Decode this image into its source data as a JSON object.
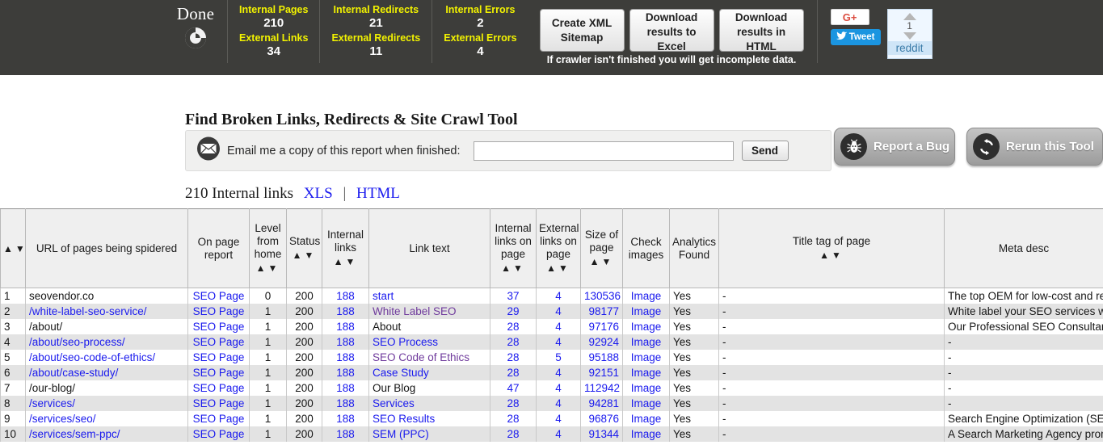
{
  "topbar": {
    "status": "Done",
    "spinner_icon": "spinner-icon",
    "stats": [
      {
        "label": "Internal Pages",
        "value": "210",
        "label2": "External Links",
        "value2": "34"
      },
      {
        "label": "Internal Redirects",
        "value": "21",
        "label2": "External Redirects",
        "value2": "11"
      },
      {
        "label": "Internal Errors",
        "value": "2",
        "label2": "External Errors",
        "value2": "4"
      }
    ],
    "buttons": [
      "Create XML Sitemap",
      "Download results to Excel",
      "Download results in HTML"
    ],
    "crawler_note": "If crawler isn't finished you will get incomplete data.",
    "social": {
      "gplus_label": "G+",
      "tweet_label": "Tweet",
      "reddit_count": "1",
      "reddit_label": "reddit"
    }
  },
  "main": {
    "page_title": "Find Broken Links, Redirects & Site Crawl Tool",
    "email_label": "Email me a copy of this report when finished:",
    "email_value": "",
    "email_placeholder": "",
    "send_label": "Send",
    "report_bug_label": "Report a Bug",
    "rerun_label": "Rerun this Tool",
    "links_summary": "210 Internal links",
    "xls_label": "XLS",
    "separator": "|",
    "html_label": "HTML"
  },
  "table": {
    "headers": [
      {
        "label": "",
        "sort": true
      },
      {
        "label": "URL of pages being spidered",
        "sort": false
      },
      {
        "label": "On page report",
        "sort": false
      },
      {
        "label": "Level from home",
        "sort": true
      },
      {
        "label": "Status",
        "sort": true
      },
      {
        "label": "Internal links",
        "sort": true
      },
      {
        "label": "Link text",
        "sort": false
      },
      {
        "label": "Internal links on page",
        "sort": true
      },
      {
        "label": "External links on page",
        "sort": true
      },
      {
        "label": "Size of page",
        "sort": true
      },
      {
        "label": "Check images",
        "sort": false
      },
      {
        "label": "Analytics Found",
        "sort": false
      },
      {
        "label": "Title tag of page",
        "sort": true
      },
      {
        "label": "Meta desc",
        "sort": false
      }
    ],
    "sort_up": "▲",
    "sort_down": "▼",
    "rows": [
      {
        "n": "1",
        "url": "seovendor.co",
        "url_style": "black",
        "report": "SEO Page",
        "level": "0",
        "status": "200",
        "internal": "188",
        "text": "start",
        "text_style": "link",
        "intpage": "37",
        "extpage": "4",
        "size": "130536",
        "images": "Image",
        "analytics": "Yes",
        "title": "-",
        "meta": "The top OEM for low-cost and re"
      },
      {
        "n": "2",
        "url": "/white-label-seo-service/",
        "url_style": "link",
        "report": "SEO Page",
        "level": "1",
        "status": "200",
        "internal": "188",
        "text": "White Label SEO",
        "text_style": "visited",
        "intpage": "29",
        "extpage": "4",
        "size": "98177",
        "images": "Image",
        "analytics": "Yes",
        "title": "-",
        "meta": "White label your SEO services wi"
      },
      {
        "n": "3",
        "url": "/about/",
        "url_style": "black",
        "report": "SEO Page",
        "level": "1",
        "status": "200",
        "internal": "188",
        "text": "About",
        "text_style": "black",
        "intpage": "28",
        "extpage": "4",
        "size": "97176",
        "images": "Image",
        "analytics": "Yes",
        "title": "-",
        "meta": "Our Professional SEO Consultant"
      },
      {
        "n": "4",
        "url": "/about/seo-process/",
        "url_style": "link",
        "report": "SEO Page",
        "level": "1",
        "status": "200",
        "internal": "188",
        "text": "SEO Process",
        "text_style": "link",
        "intpage": "28",
        "extpage": "4",
        "size": "92924",
        "images": "Image",
        "analytics": "Yes",
        "title": "-",
        "meta": "-"
      },
      {
        "n": "5",
        "url": "/about/seo-code-of-ethics/",
        "url_style": "link",
        "report": "SEO Page",
        "level": "1",
        "status": "200",
        "internal": "188",
        "text": "SEO Code of Ethics",
        "text_style": "visited",
        "intpage": "28",
        "extpage": "5",
        "size": "95188",
        "images": "Image",
        "analytics": "Yes",
        "title": "-",
        "meta": "-"
      },
      {
        "n": "6",
        "url": "/about/case-study/",
        "url_style": "link",
        "report": "SEO Page",
        "level": "1",
        "status": "200",
        "internal": "188",
        "text": "Case Study",
        "text_style": "link",
        "intpage": "28",
        "extpage": "4",
        "size": "92151",
        "images": "Image",
        "analytics": "Yes",
        "title": "-",
        "meta": "-"
      },
      {
        "n": "7",
        "url": "/our-blog/",
        "url_style": "black",
        "report": "SEO Page",
        "level": "1",
        "status": "200",
        "internal": "188",
        "text": "Our Blog",
        "text_style": "black",
        "intpage": "47",
        "extpage": "4",
        "size": "112942",
        "images": "Image",
        "analytics": "Yes",
        "title": "-",
        "meta": "-"
      },
      {
        "n": "8",
        "url": "/services/",
        "url_style": "link",
        "report": "SEO Page",
        "level": "1",
        "status": "200",
        "internal": "188",
        "text": "Services",
        "text_style": "link",
        "intpage": "28",
        "extpage": "4",
        "size": "94281",
        "images": "Image",
        "analytics": "Yes",
        "title": "-",
        "meta": "-"
      },
      {
        "n": "9",
        "url": "/services/seo/",
        "url_style": "link",
        "report": "SEO Page",
        "level": "1",
        "status": "200",
        "internal": "188",
        "text": "SEO Results",
        "text_style": "link",
        "intpage": "28",
        "extpage": "4",
        "size": "96876",
        "images": "Image",
        "analytics": "Yes",
        "title": "-",
        "meta": "Search Engine Optimization (SEO"
      },
      {
        "n": "10",
        "url": "/services/sem-ppc/",
        "url_style": "link",
        "report": "SEO Page",
        "level": "1",
        "status": "200",
        "internal": "188",
        "text": "SEM (PPC)",
        "text_style": "link",
        "intpage": "28",
        "extpage": "4",
        "size": "91344",
        "images": "Image",
        "analytics": "Yes",
        "title": "-",
        "meta": "A Search Marketing Agency prom"
      }
    ]
  },
  "colors": {
    "topbar_bg": "#3d3d3a",
    "stat_label": "#f2f200",
    "link": "#1a1aee",
    "visited": "#6f3a9c"
  }
}
